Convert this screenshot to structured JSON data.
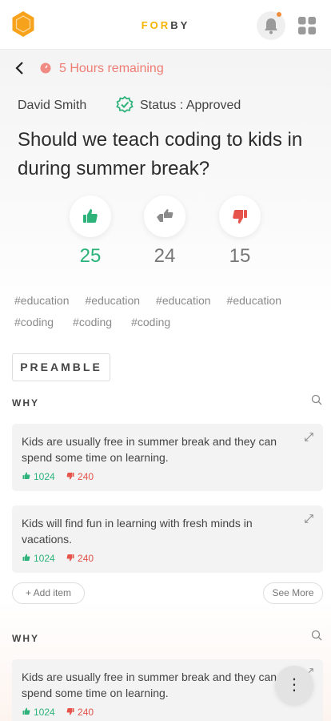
{
  "header": {
    "brand_part1": "FOR",
    "brand_part2": "BY",
    "brand_color": "#f5b400",
    "logo_color": "#f7a21b",
    "notification_dot": true
  },
  "poll": {
    "remaining": "5 Hours remaining",
    "author": "David Smith",
    "status": "Status : Approved",
    "question": "Should we teach coding to kids in during summer break?",
    "votes": {
      "up": "25",
      "neutral": "24",
      "down": "15"
    },
    "colors": {
      "up": "#2db37a",
      "neutral": "#777777",
      "down": "#e5534b",
      "remaining": "#ee7d74"
    },
    "tags_row1": [
      "#education",
      "#education",
      "#education",
      "#education"
    ],
    "tags_row2": [
      "#coding",
      "#coding",
      "#coding"
    ]
  },
  "preamble_label": "PREAMBLE",
  "sections": [
    {
      "title": "WHY",
      "items": [
        {
          "text": "Kids are usually free in summer break and they can spend some time on learning.",
          "up": "1024",
          "down": "240"
        },
        {
          "text": "Kids will find fun in learning with fresh minds in vacations.",
          "up": "1024",
          "down": "240"
        }
      ],
      "add_label": "+ Add item",
      "more_label": "See More"
    },
    {
      "title": "WHY",
      "items": [
        {
          "text": "Kids are usually free in summer break and they can spend some time on learning.",
          "up": "1024",
          "down": "240"
        }
      ]
    }
  ],
  "fab_label": "⋮"
}
